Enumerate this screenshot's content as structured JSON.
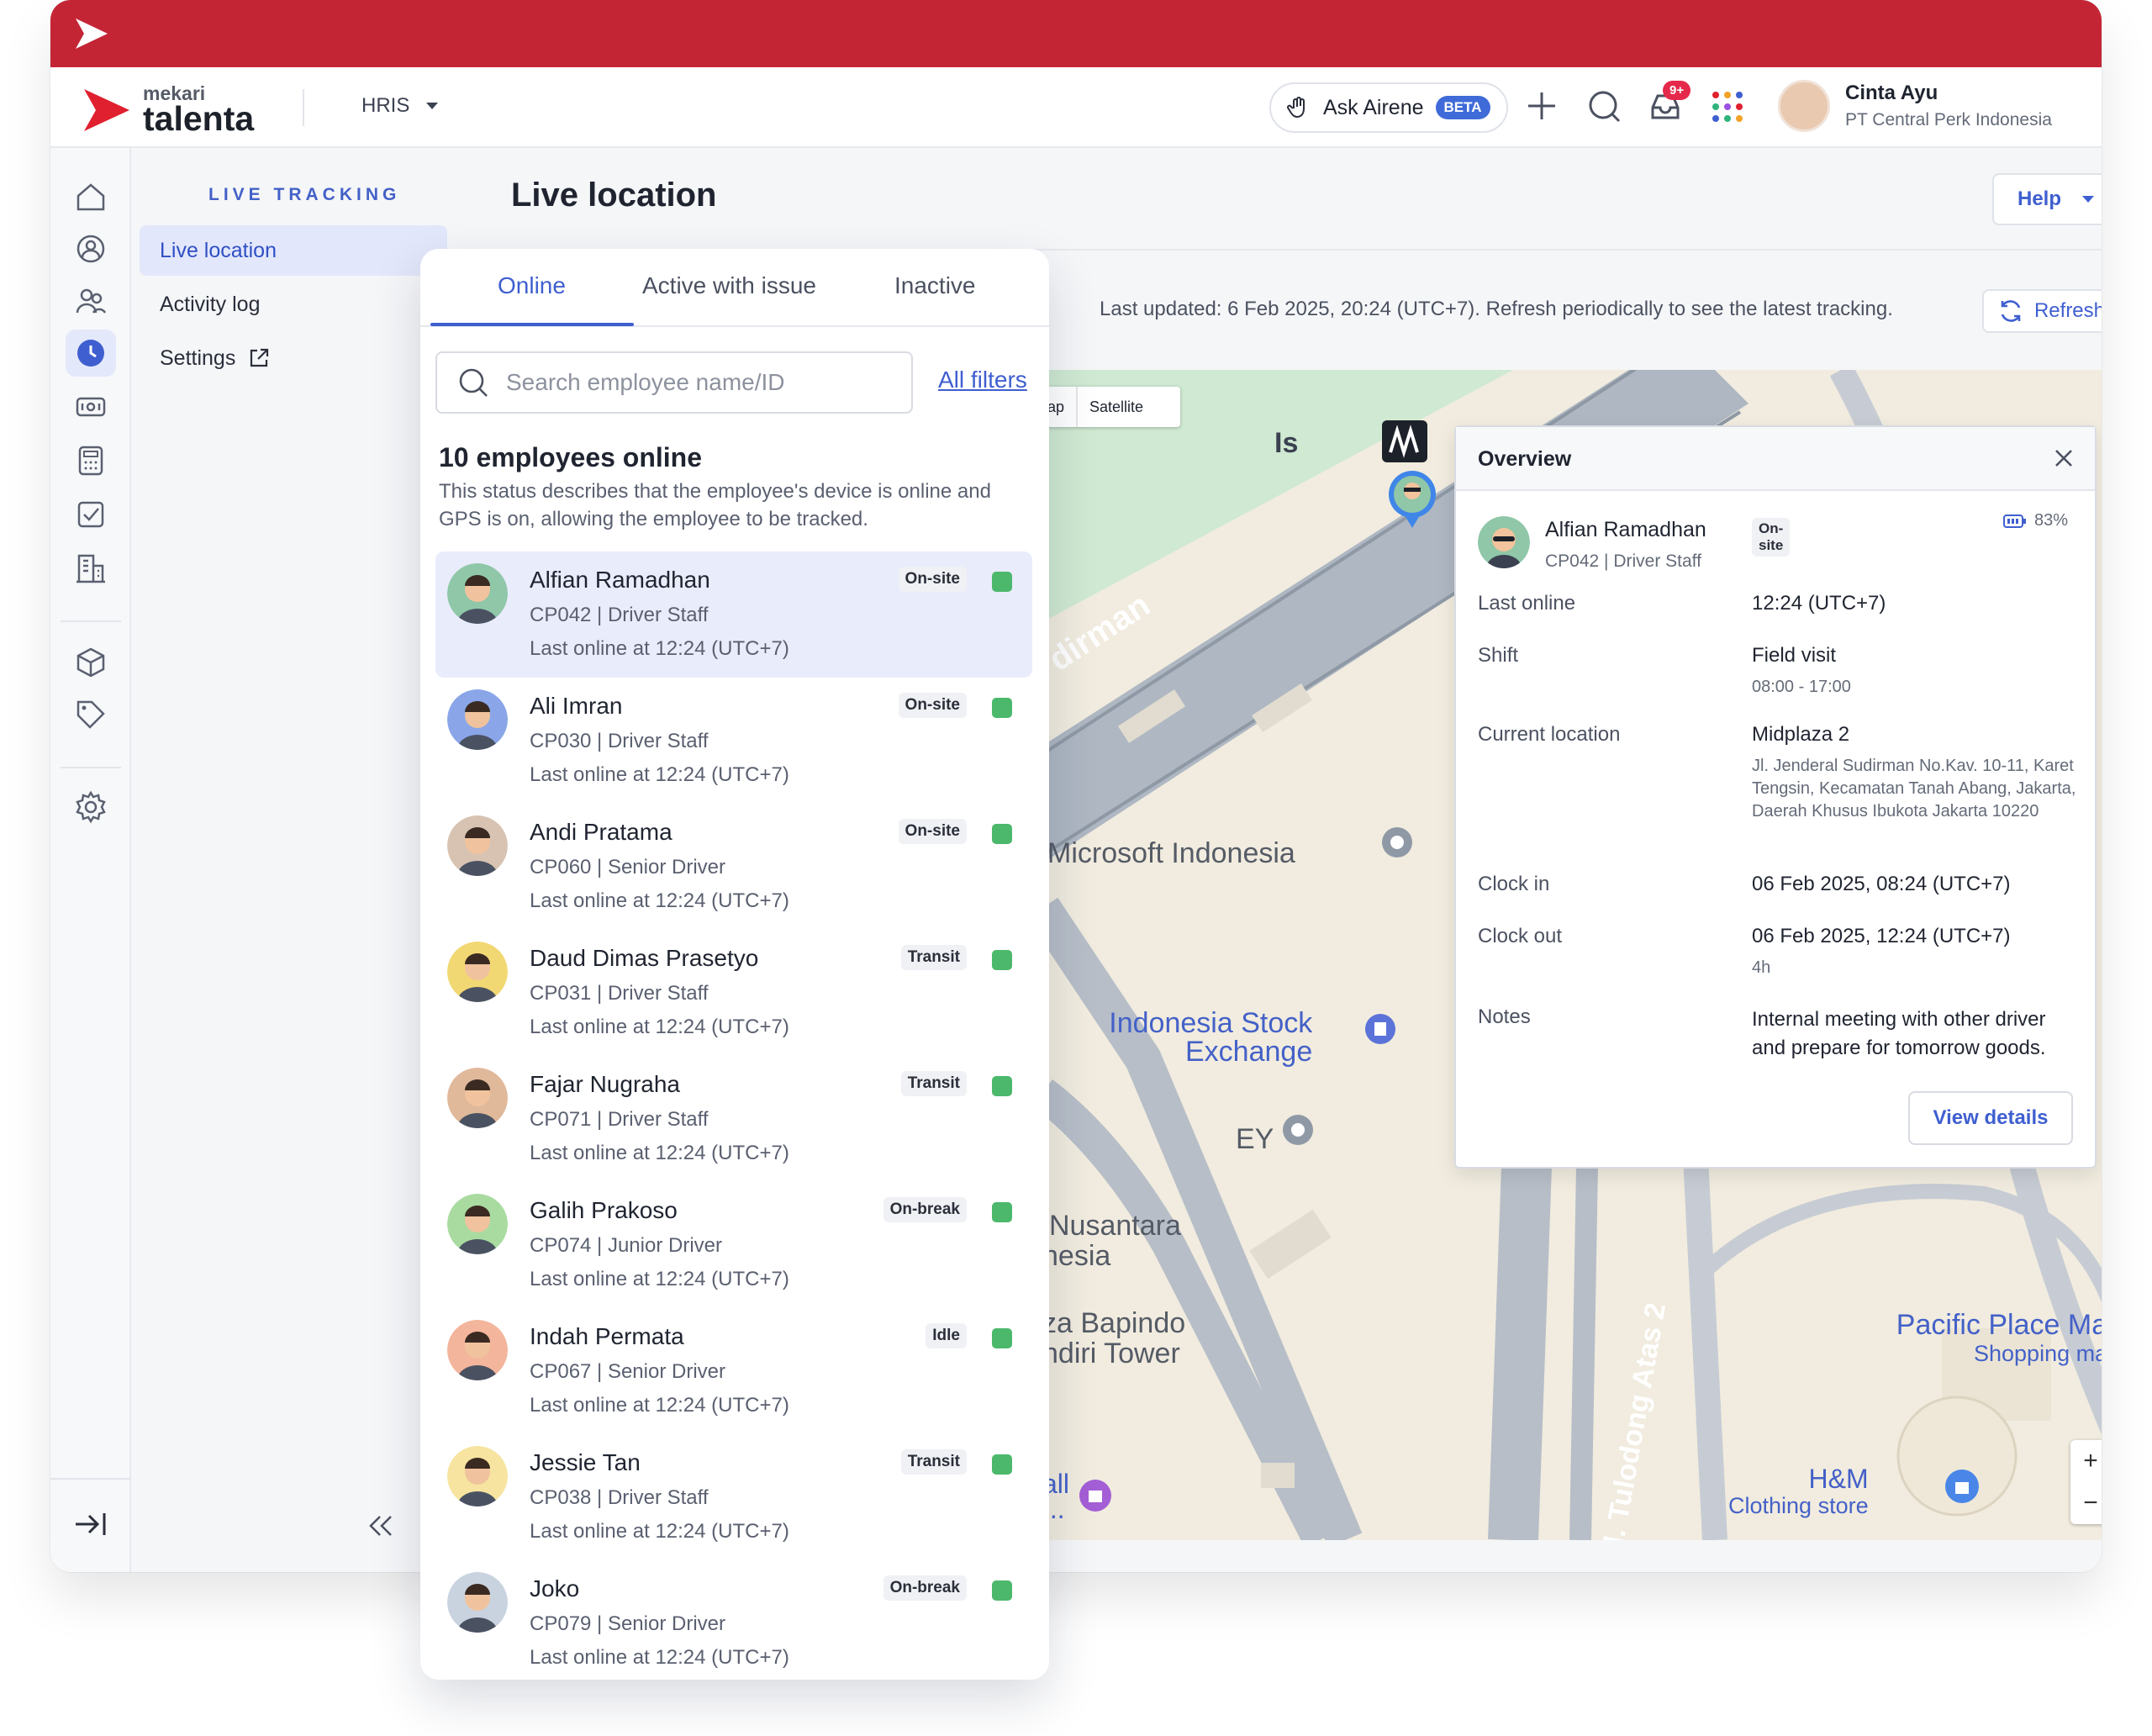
{
  "brand": {
    "logo_small": "mekari",
    "logo_big": "talenta",
    "accent": "#c42535",
    "primary": "#3f5fd0"
  },
  "topbar": {
    "module": "HRIS",
    "ask_label": "Ask Airene",
    "beta": "BETA",
    "notif_badge": "9+",
    "user_name": "Cinta Ayu",
    "user_company": "PT Central Perk Indonesia"
  },
  "icon_rail": [
    "home-icon",
    "profile-icon",
    "people-icon",
    "clock-icon",
    "payroll-icon",
    "calculator-icon",
    "task-icon",
    "building-icon",
    "box-icon",
    "tag-icon",
    "settings-icon"
  ],
  "subnav": {
    "section": "LIVE TRACKING",
    "items": [
      "Live location",
      "Activity log",
      "Settings"
    ]
  },
  "main": {
    "title": "Live location",
    "help": "Help",
    "last_updated": "Last updated: 6 Feb 2025, 20:24 (UTC+7). Refresh periodically to see the latest tracking.",
    "refresh": "Refresh"
  },
  "panel": {
    "tabs": [
      "Online",
      "Active with issue",
      "Inactive"
    ],
    "search_placeholder": "Search employee name/ID",
    "all_filters": "All filters",
    "count_title": "10 employees online",
    "description": "This status describes that the employee's device is online and GPS is on, allowing the employee to be tracked.",
    "employees": [
      {
        "name": "Alfian Ramadhan",
        "role": "CP042 | Driver Staff",
        "last": "Last online at 12:24 (UTC+7)",
        "status": "On-site",
        "avatar": "#8fc7a8"
      },
      {
        "name": "Ali Imran",
        "role": "CP030 | Driver Staff",
        "last": "Last online at 12:24 (UTC+7)",
        "status": "On-site",
        "avatar": "#8aa6e8"
      },
      {
        "name": "Andi Pratama",
        "role": "CP060 | Senior Driver",
        "last": "Last online at 12:24 (UTC+7)",
        "status": "On-site",
        "avatar": "#d8c3b2"
      },
      {
        "name": "Daud Dimas Prasetyo",
        "role": "CP031 | Driver Staff",
        "last": "Last online at 12:24 (UTC+7)",
        "status": "Transit",
        "avatar": "#f2d873"
      },
      {
        "name": "Fajar Nugraha",
        "role": "CP071 | Driver Staff",
        "last": "Last online at 12:24 (UTC+7)",
        "status": "Transit",
        "avatar": "#e0b89a"
      },
      {
        "name": "Galih Prakoso",
        "role": "CP074 | Junior Driver",
        "last": "Last online at 12:24 (UTC+7)",
        "status": "On-break",
        "avatar": "#a9dba0"
      },
      {
        "name": "Indah Permata",
        "role": "CP067 | Senior Driver",
        "last": "Last online at 12:24 (UTC+7)",
        "status": "Idle",
        "avatar": "#f3b59c"
      },
      {
        "name": "Jessie Tan",
        "role": "CP038 | Driver Staff",
        "last": "Last online at 12:24 (UTC+7)",
        "status": "Transit",
        "avatar": "#f6e4a0"
      },
      {
        "name": "Joko",
        "role": "CP079 | Senior Driver",
        "last": "Last online at 12:24 (UTC+7)",
        "status": "On-break",
        "avatar": "#c9d3e0"
      }
    ]
  },
  "map": {
    "toggle_map": "lap",
    "toggle_sat": "Satellite",
    "labels": {
      "sudirman": "dirman",
      "microsoft": "Microsoft Indonesia",
      "idx1": "Indonesia Stock",
      "idx2": "Exchange",
      "ey": "EY",
      "nusantara1": "Nusantara",
      "nusantara2": "nesia",
      "bapindo1": "za Bapindo",
      "bapindo2": "ndiri Tower",
      "tulodong": "Jl. Tulodong Atas 2",
      "pacific1": "Pacific Place Ma",
      "pacific2": "Shopping ma",
      "hm1": "H&M",
      "hm2": "Clothing store",
      "mall1": "all",
      "mall2": "...",
      "is": "Is"
    },
    "zoom_in": "+",
    "zoom_out": "−"
  },
  "overview": {
    "title": "Overview",
    "name": "Alfian Ramadhan",
    "status": "On-site",
    "role": "CP042 | Driver Staff",
    "battery": "83%",
    "last_online_label": "Last online",
    "last_online": "12:24 (UTC+7)",
    "shift_label": "Shift",
    "shift": "Field visit",
    "shift_time": "08:00 - 17:00",
    "location_label": "Current location",
    "location": "Midplaza 2",
    "address": "Jl. Jenderal Sudirman No.Kav. 10-11, Karet Tengsin, Kecamatan Tanah Abang, Jakarta, Daerah Khusus Ibukota Jakarta 10220",
    "clock_in_label": "Clock in",
    "clock_in": "06 Feb 2025, 08:24 (UTC+7)",
    "clock_out_label": "Clock out",
    "clock_out": "06 Feb 2025, 12:24 (UTC+7)",
    "duration": "4h",
    "notes_label": "Notes",
    "notes": "Internal meeting with other driver and prepare for tomorrow goods.",
    "view_details": "View details"
  }
}
